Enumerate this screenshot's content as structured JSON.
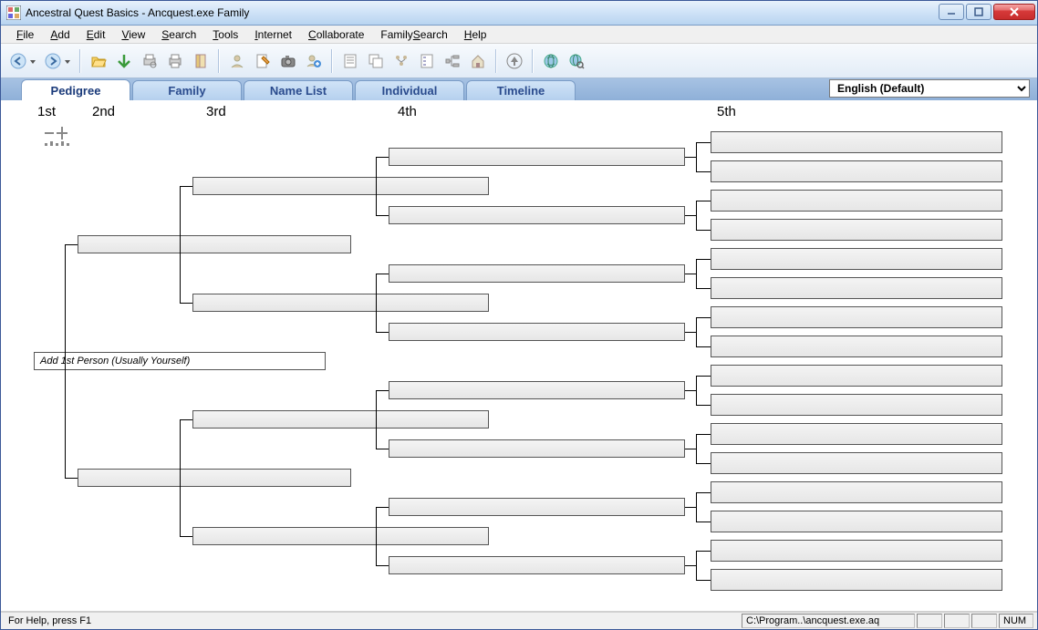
{
  "window": {
    "title": "Ancestral Quest Basics - Ancquest.exe Family"
  },
  "menu": {
    "items": [
      {
        "label": "File",
        "u": 0
      },
      {
        "label": "Add",
        "u": 0
      },
      {
        "label": "Edit",
        "u": 0
      },
      {
        "label": "View",
        "u": 0
      },
      {
        "label": "Search",
        "u": 0
      },
      {
        "label": "Tools",
        "u": 0
      },
      {
        "label": "Internet",
        "u": 0
      },
      {
        "label": "Collaborate",
        "u": 0
      },
      {
        "label": "FamilySearch",
        "u": 6
      },
      {
        "label": "Help",
        "u": 0
      }
    ]
  },
  "tabs": [
    {
      "label": "Pedigree",
      "active": true
    },
    {
      "label": "Family",
      "active": false
    },
    {
      "label": "Name List",
      "active": false
    },
    {
      "label": "Individual",
      "active": false
    },
    {
      "label": "Timeline",
      "active": false
    }
  ],
  "language": {
    "selected": "English (Default)"
  },
  "generations": {
    "g1": "1st",
    "g2": "2nd",
    "g3": "3rd",
    "g4": "4th",
    "g5": "5th"
  },
  "pedigree": {
    "root_hint": "Add 1st Person (Usually Yourself)"
  },
  "status": {
    "help": "For Help, press F1",
    "path": "C:\\Program..\\ancquest.exe.aq",
    "num": "NUM"
  },
  "toolbar_icons": [
    "nav-back-icon",
    "nav-forward-icon",
    "open-folder-icon",
    "save-icon",
    "print-preview-icon",
    "print-icon",
    "cut-icon",
    "add-person-icon",
    "edit-person-icon",
    "camera-icon",
    "add-contact-icon",
    "notes-icon",
    "cascade-icon",
    "family-group-icon",
    "descendants-icon",
    "ancestors-icon",
    "home-icon",
    "up-arrow-icon",
    "globe-refresh-icon",
    "globe-search-icon"
  ]
}
